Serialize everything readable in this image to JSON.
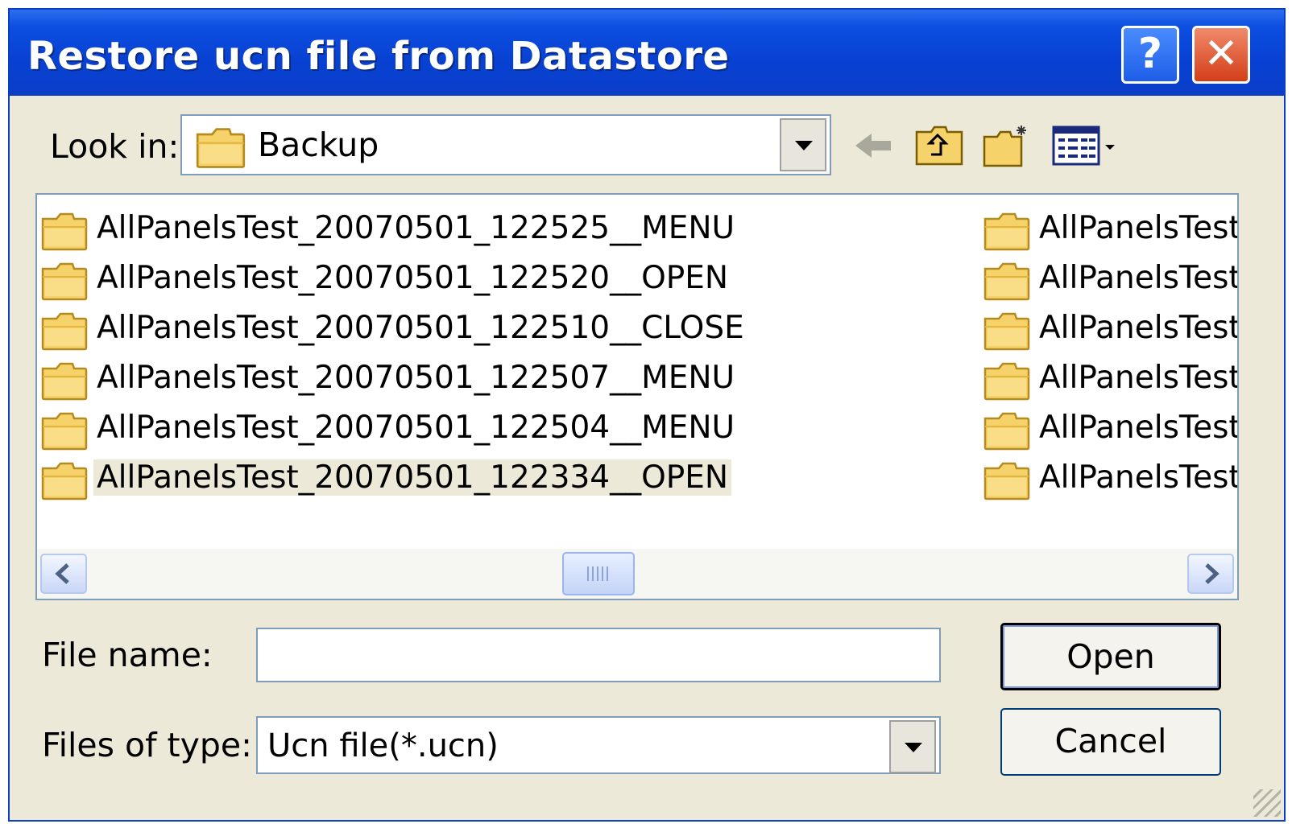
{
  "window": {
    "title": "Restore ucn file from Datastore",
    "help_glyph": "?",
    "close_glyph": "✕"
  },
  "toolbar": {
    "look_in_label": "Look in:",
    "look_in_value": "Backup",
    "icons": [
      "back-arrow-icon",
      "up-one-level-icon",
      "new-folder-icon",
      "view-menu-icon"
    ]
  },
  "files": {
    "column1": [
      {
        "name": "AllPanelsTest_20070501_122525__MENU",
        "selected": false
      },
      {
        "name": "AllPanelsTest_20070501_122520__OPEN",
        "selected": false
      },
      {
        "name": "AllPanelsTest_20070501_122510__CLOSE",
        "selected": false
      },
      {
        "name": "AllPanelsTest_20070501_122507__MENU",
        "selected": false
      },
      {
        "name": "AllPanelsTest_20070501_122504__MENU",
        "selected": false
      },
      {
        "name": "AllPanelsTest_20070501_122334__OPEN",
        "selected": true
      }
    ],
    "column2": [
      {
        "name": "AllPanelsTest_"
      },
      {
        "name": "AllPanelsTest_"
      },
      {
        "name": "AllPanelsTest_"
      },
      {
        "name": "AllPanelsTest_"
      },
      {
        "name": "AllPanelsTest_"
      },
      {
        "name": "AllPanelsTest_"
      }
    ]
  },
  "form": {
    "file_name_label": "File name:",
    "file_name_value": "",
    "file_type_label": "Files of type:",
    "file_type_value": "Ucn file(*.ucn)"
  },
  "buttons": {
    "open": "Open",
    "cancel": "Cancel"
  },
  "colors": {
    "titlebar": "#0a3ec8",
    "dialog_bg": "#ece9d8",
    "close_red": "#d43e1a"
  }
}
